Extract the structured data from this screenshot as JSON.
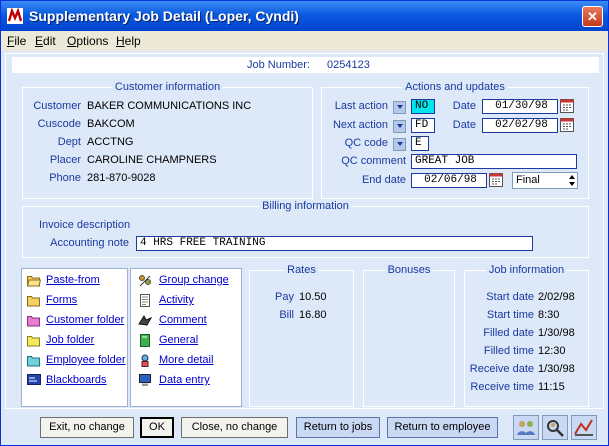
{
  "window": {
    "title": "Supplementary Job Detail (Loper, Cyndi)",
    "close_glyph": "✕"
  },
  "menu": [
    {
      "key": "F",
      "rest": "ile"
    },
    {
      "key": "E",
      "rest": "dit"
    },
    {
      "key": "O",
      "rest": "ptions"
    },
    {
      "key": "H",
      "rest": "elp"
    }
  ],
  "job": {
    "label": "Job Number:",
    "value": "0254123"
  },
  "customer": {
    "title": "Customer information",
    "fields": [
      {
        "label": "Customer",
        "value": "BAKER COMMUNICATIONS INC"
      },
      {
        "label": "Cuscode",
        "value": "BAKCOM"
      },
      {
        "label": "Dept",
        "value": "ACCTNG"
      },
      {
        "label": "Placer",
        "value": "CAROLINE CHAMPNERS"
      },
      {
        "label": "Phone",
        "value": "281-870-9028"
      }
    ]
  },
  "actions": {
    "title": "Actions and updates",
    "last_action": {
      "label": "Last action",
      "value": "NO",
      "date_label": "Date",
      "date": "01/30/98"
    },
    "next_action": {
      "label": "Next action",
      "value": "FD",
      "date_label": "Date",
      "date": "02/02/98"
    },
    "qc_code": {
      "label": "QC code",
      "value": "E"
    },
    "qc_comment": {
      "label": "QC comment",
      "value": "GREAT JOB"
    },
    "end_date": {
      "label": "End date",
      "value": "02/06/98",
      "status": "Final"
    }
  },
  "billing": {
    "title": "Billing information",
    "invoice_label": "Invoice description",
    "accounting_label": "Accounting note",
    "accounting_value": "4 HRS FREE TRAINING"
  },
  "nav_left": [
    {
      "label": "Paste-from",
      "icon": "folder-open-icon"
    },
    {
      "label": "Forms",
      "icon": "folder-icon"
    },
    {
      "label": "Customer folder",
      "icon": "folder-icon"
    },
    {
      "label": "Job folder",
      "icon": "folder-icon"
    },
    {
      "label": "Employee folder",
      "icon": "folder-icon"
    },
    {
      "label": "Blackboards",
      "icon": "blackboard-icon"
    }
  ],
  "nav_right": [
    {
      "label": "Group change",
      "icon": "group-change-icon"
    },
    {
      "label": "Activity",
      "icon": "document-icon"
    },
    {
      "label": "Comment",
      "icon": "comment-icon"
    },
    {
      "label": "General",
      "icon": "general-book-icon"
    },
    {
      "label": "More detail",
      "icon": "more-detail-icon"
    },
    {
      "label": "Data entry",
      "icon": "monitor-icon"
    }
  ],
  "rates": {
    "title": "Rates",
    "pay_label": "Pay",
    "pay": "10.50",
    "bill_label": "Bill",
    "bill": "16.80"
  },
  "bonuses": {
    "title": "Bonuses"
  },
  "job_info": {
    "title": "Job information",
    "fields": [
      {
        "label": "Start date",
        "value": "2/02/98"
      },
      {
        "label": "Start time",
        "value": "8:30"
      },
      {
        "label": "Filled date",
        "value": "1/30/98"
      },
      {
        "label": "Filled time",
        "value": "12:30"
      },
      {
        "label": "Receive date",
        "value": "1/30/98"
      },
      {
        "label": "Receive time",
        "value": "11:15"
      }
    ]
  },
  "buttons": {
    "exit": "Exit, no change",
    "ok": "OK",
    "close": "Close, no change",
    "return_jobs": "Return to jobs",
    "return_employee": "Return to employee"
  },
  "colors": {
    "title_bar": "#0a5ae0",
    "accent": "#1a3aa0",
    "highlight_cyan": "#00e5ee",
    "panel": "#dde8f8"
  }
}
